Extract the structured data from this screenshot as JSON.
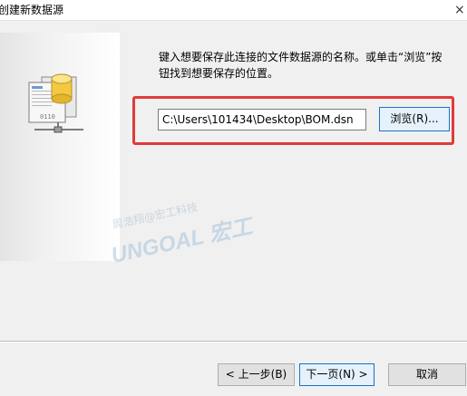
{
  "window": {
    "title": "创建新数据源",
    "close_glyph": "×"
  },
  "instructions": {
    "line1": "键入想要保存此连接的文件数据源的名称。或单击“浏览”按",
    "line2": "钮找到想要保存的位置。"
  },
  "file_name_input": {
    "value": "C:\\Users\\101434\\Desktop\\BOM.dsn"
  },
  "buttons": {
    "browse": "浏览(R)...",
    "back": "< 上一步(B)",
    "next": "下一页(N) >",
    "cancel": "取消"
  },
  "watermark": {
    "line1": "周浩翔@宏工科技",
    "line2": "UNGOAL 宏工"
  },
  "colors": {
    "highlight": "#e23a3a",
    "focus_border": "#1a72c6"
  },
  "icons": {
    "illustration": "database-file-network-icon"
  }
}
